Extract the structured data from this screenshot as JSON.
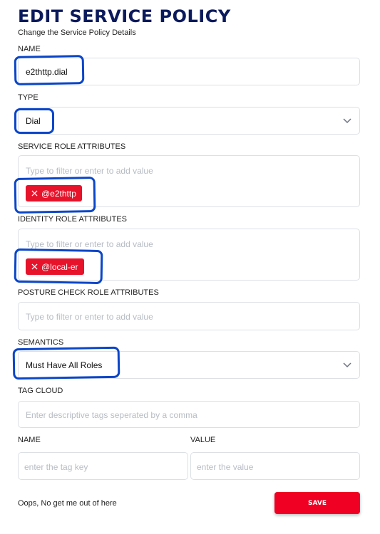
{
  "header": {
    "title": "EDIT SERVICE POLICY",
    "subtitle": "Change the Service Policy Details"
  },
  "form": {
    "name": {
      "label": "NAME",
      "value": "e2thttp.dial"
    },
    "type": {
      "label": "TYPE",
      "value": "Dial"
    },
    "service_roles": {
      "label": "SERVICE ROLE ATTRIBUTES",
      "placeholder": "Type to filter or enter to add value",
      "chips": [
        "@e2thttp"
      ]
    },
    "identity_roles": {
      "label": "IDENTITY ROLE ATTRIBUTES",
      "placeholder": "Type to filter or enter to add value",
      "chips": [
        "@local-er"
      ]
    },
    "posture_roles": {
      "label": "POSTURE CHECK ROLE ATTRIBUTES",
      "placeholder": "Type to filter or enter to add value"
    },
    "semantics": {
      "label": "SEMANTICS",
      "value": "Must Have All Roles"
    },
    "tag_cloud": {
      "label": "TAG CLOUD",
      "placeholder": "Enter descriptive tags seperated by a comma"
    },
    "tag_name": {
      "label": "NAME",
      "placeholder": "enter the tag key"
    },
    "tag_value": {
      "label": "VALUE",
      "placeholder": "enter the value"
    }
  },
  "footer": {
    "cancel_label": "Oops, No get me out of here",
    "save_label": "SAVE"
  },
  "colors": {
    "title": "#0b1a5c",
    "chip": "#e6132b",
    "save_button": "#f00022",
    "annotation": "#0a46c9"
  }
}
